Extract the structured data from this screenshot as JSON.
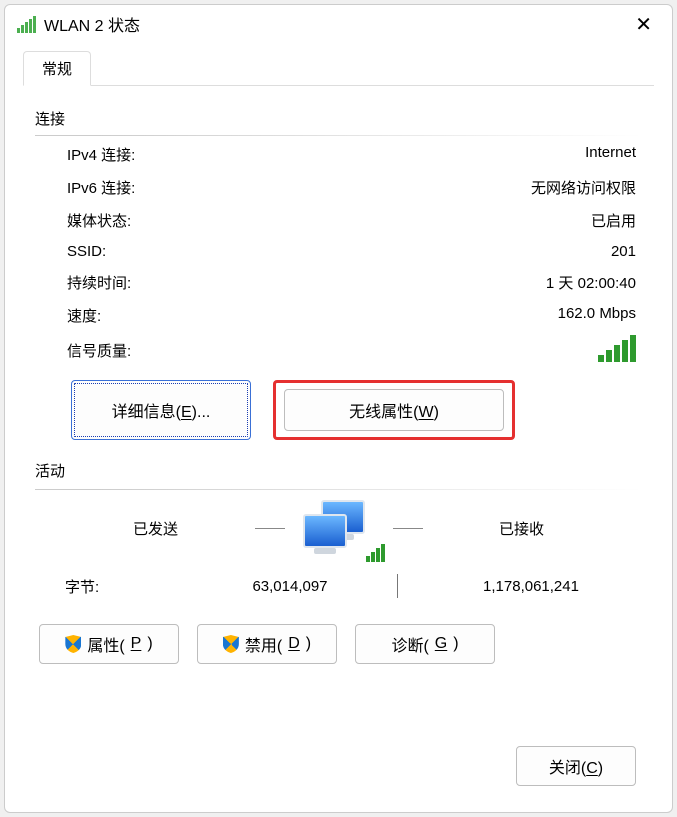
{
  "window": {
    "title": "WLAN 2 状态"
  },
  "tab": {
    "general": "常规"
  },
  "connection": {
    "group_label": "连接",
    "ipv4_label": "IPv4 连接:",
    "ipv4_value": "Internet",
    "ipv6_label": "IPv6 连接:",
    "ipv6_value": "无网络访问权限",
    "media_label": "媒体状态:",
    "media_value": "已启用",
    "ssid_label": "SSID:",
    "ssid_value": "201",
    "duration_label": "持续时间:",
    "duration_value": "1 天 02:00:40",
    "speed_label": "速度:",
    "speed_value": "162.0 Mbps",
    "signal_label": "信号质量:"
  },
  "buttons": {
    "details_base": "详细信息(",
    "details_hotkey": "E",
    "details_tail": ")...",
    "wireless_base": "无线属性(",
    "wireless_hotkey": "W",
    "wireless_tail": ")",
    "properties_base": "属性(",
    "properties_hotkey": "P",
    "properties_tail": ")",
    "disable_base": "禁用(",
    "disable_hotkey": "D",
    "disable_tail": ")",
    "diagnose_base": "诊断(",
    "diagnose_hotkey": "G",
    "diagnose_tail": ")",
    "close_base": "关闭(",
    "close_hotkey": "C",
    "close_tail": ")"
  },
  "activity": {
    "group_label": "活动",
    "sent_label": "已发送",
    "recv_label": "已接收",
    "bytes_label": "字节:",
    "bytes_sent": "63,014,097",
    "bytes_recv": "1,178,061,241"
  }
}
